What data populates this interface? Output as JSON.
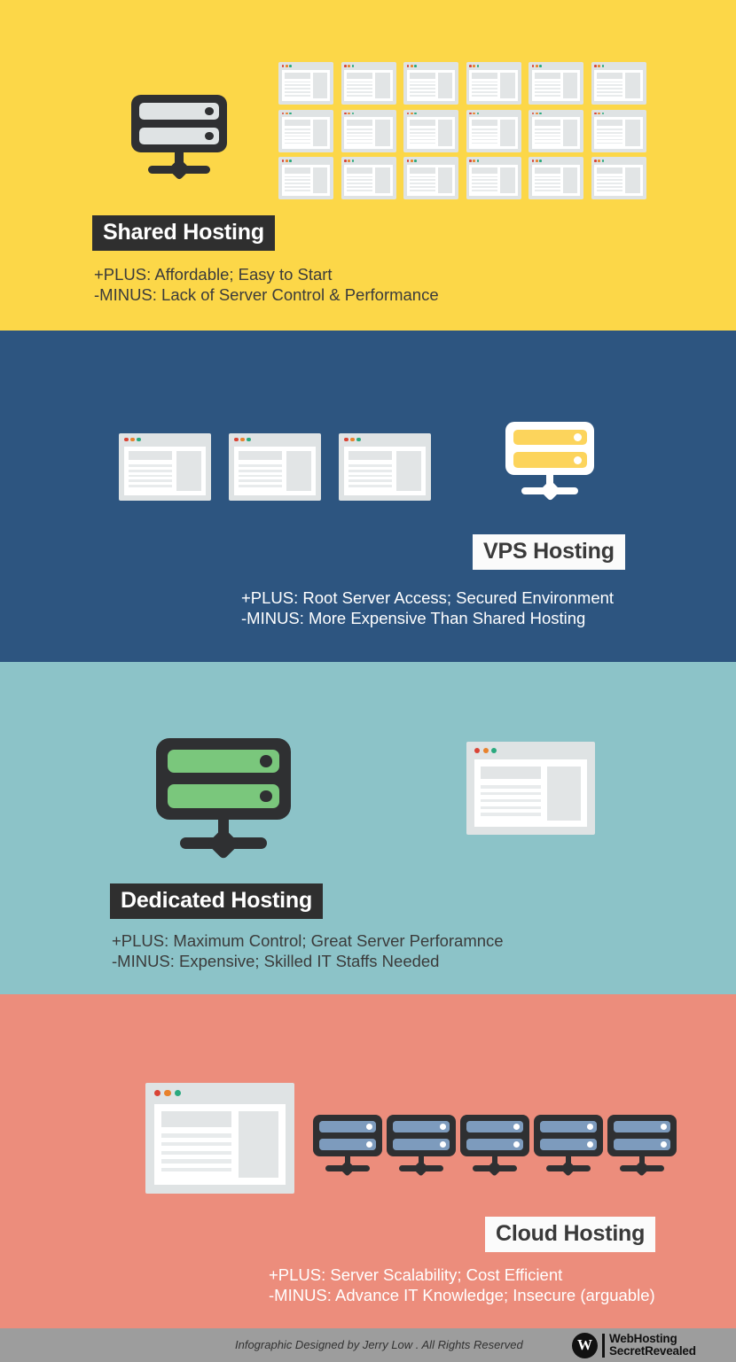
{
  "sections": [
    {
      "id": "shared",
      "title": "Shared Hosting",
      "plus": "+PLUS:  Affordable; Easy to Start",
      "minus": "-MINUS: Lack of Server Control & Performance",
      "bg_color": "#fcd748",
      "chip_style": "dark",
      "text_style": "dark",
      "server_count": 1,
      "card_count": 18
    },
    {
      "id": "vps",
      "title": "VPS Hosting",
      "plus": "+PLUS:  Root Server Access; Secured Environment",
      "minus": "-MINUS: More Expensive Than Shared Hosting",
      "bg_color": "#2d5580",
      "chip_style": "light",
      "text_style": "light",
      "server_count": 1,
      "card_count": 3
    },
    {
      "id": "dedicated",
      "title": "Dedicated Hosting",
      "plus": "+PLUS:  Maximum Control; Great Server Perforamnce",
      "minus": "-MINUS: Expensive; Skilled IT Staffs Needed",
      "bg_color": "#8cc3c8",
      "chip_style": "dark",
      "text_style": "dark",
      "server_count": 1,
      "card_count": 1
    },
    {
      "id": "cloud",
      "title": "Cloud Hosting",
      "plus": "+PLUS:  Server Scalability; Cost Efficient",
      "minus": "-MINUS: Advance IT Knowledge; Insecure (arguable)",
      "bg_color": "#ec8d7c",
      "chip_style": "light",
      "text_style": "light",
      "server_count": 5,
      "card_count": 1
    }
  ],
  "footer": {
    "credit": "Infographic Designed by Jerry Low . All Rights Reserved",
    "logo_mark": "W",
    "logo_line1": "WebHosting",
    "logo_line2": "SecretRevealed"
  },
  "palette": {
    "yellow": "#fcd748",
    "blue": "#2d5580",
    "teal": "#8cc3c8",
    "salmon": "#ec8d7c",
    "footer_gray": "#9d9d9d",
    "chip_dark": "#2f2f2f",
    "chip_light": "#fbfbfb",
    "server_dark": "#2f3032",
    "server_green": "#7ac77c",
    "server_yellow": "#fcd45c",
    "server_blue": "#7d9bbd",
    "card_body": "#dfe3e4",
    "dot_red": "#d94436",
    "dot_orange": "#e8822c",
    "dot_green": "#2aa97e"
  }
}
